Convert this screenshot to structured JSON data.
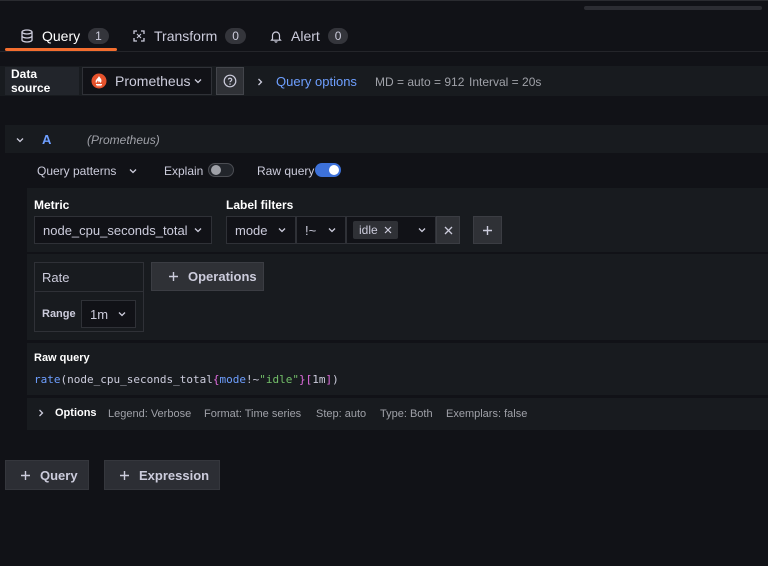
{
  "tabs": [
    {
      "label": "Query",
      "count": "1",
      "icon": "database-icon"
    },
    {
      "label": "Transform",
      "count": "0",
      "icon": "transform-icon"
    },
    {
      "label": "Alert",
      "count": "0",
      "icon": "bell-icon"
    }
  ],
  "datasource": {
    "label": "Data source",
    "value": "Prometheus",
    "icon": "prometheus-icon"
  },
  "query_options": {
    "label": "Query options",
    "md": "MD = auto = 912",
    "interval": "Interval = 20s"
  },
  "query_row": {
    "ref": "A",
    "datasource": "(Prometheus)"
  },
  "toolbar": {
    "patterns": "Query patterns",
    "explain": "Explain",
    "explain_on": false,
    "raw_query": "Raw query",
    "raw_query_on": true
  },
  "metric": {
    "label": "Metric",
    "value": "node_cpu_seconds_total"
  },
  "label_filters": {
    "label": "Label filters",
    "key": "mode",
    "op": "!~",
    "value": "idle"
  },
  "operation": {
    "name": "Rate",
    "range_label": "Range",
    "range_value": "1m",
    "add_label": "Operations"
  },
  "raw": {
    "label": "Raw query",
    "fn": "rate",
    "metric": "node_cpu_seconds_total",
    "label_key": "mode",
    "op": "!~",
    "label_val": "\"idle\"",
    "range": "1m"
  },
  "options": {
    "label": "Options",
    "legend": "Legend: Verbose",
    "format": "Format: Time series",
    "step": "Step: auto",
    "type": "Type: Both",
    "exemplars": "Exemplars: false"
  },
  "add": {
    "query": "Query",
    "expression": "Expression"
  },
  "colors": {
    "accent": "#6e9fff",
    "active_tab": "#f46e2f",
    "toggle_on": "#3d71d9"
  }
}
